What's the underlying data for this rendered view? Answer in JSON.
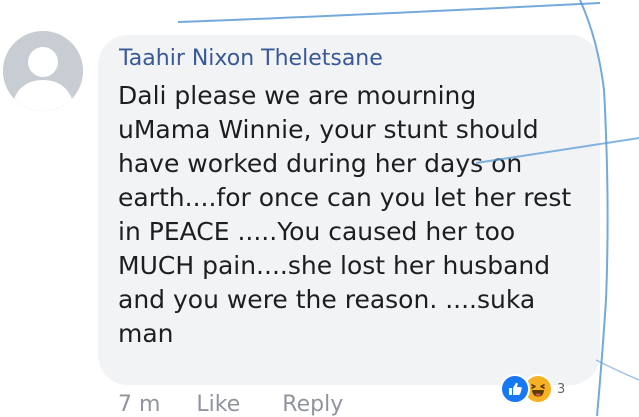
{
  "comment": {
    "author": "Taahir Nixon Theletsane",
    "lines": [
      "Dali  please we are mourning",
      "uMama Winnie, your stunt should",
      "have worked during her days on",
      "earth....for once can you let her rest",
      "in PEACE .....You caused her too",
      "MUCH pain....she lost her husband",
      "and you were the reason. ....suka",
      "man"
    ]
  },
  "reactions": {
    "icons": [
      "like-icon",
      "haha-icon"
    ],
    "count": "3",
    "colors": {
      "like": "#1877f2",
      "haha": "#f7b125"
    }
  },
  "actions": {
    "time": "7 m",
    "like_label": "Like",
    "reply_label": "Reply"
  },
  "colors": {
    "bubble": "#f2f3f5",
    "author": "#385898",
    "text": "#1c1e21",
    "meta": "#90949c",
    "annotation_lines": "#5b9bd5"
  }
}
